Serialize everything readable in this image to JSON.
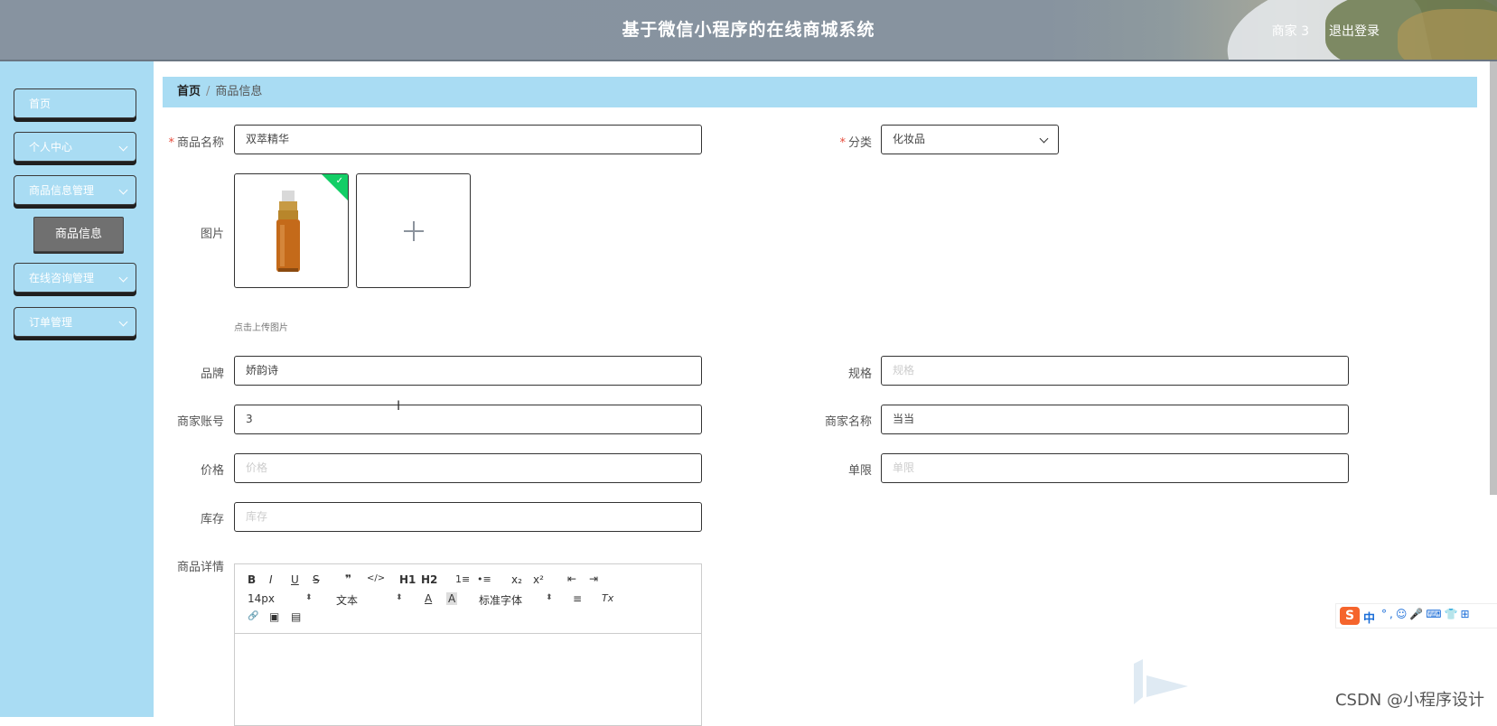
{
  "header": {
    "title": "基于微信小程序的在线商城系统",
    "user": "商家 3",
    "logout": "退出登录"
  },
  "sidebar": {
    "items": [
      {
        "label": "首页"
      },
      {
        "label": "个人中心"
      },
      {
        "label": "商品信息管理"
      },
      {
        "label": "在线咨询管理"
      },
      {
        "label": "订单管理"
      }
    ],
    "active_sub": "商品信息"
  },
  "breadcrumb": {
    "home": "首页",
    "current": "商品信息"
  },
  "form": {
    "name_label": "商品名称",
    "name_value": "双萃精华",
    "category_label": "分类",
    "category_value": "化妆品",
    "image_label": "图片",
    "upload_hint": "点击上传图片",
    "brand_label": "品牌",
    "brand_value": "娇韵诗",
    "spec_label": "规格",
    "spec_placeholder": "规格",
    "merchant_account_label": "商家账号",
    "merchant_account_value": "3",
    "merchant_name_label": "商家名称",
    "merchant_name_value": "当当",
    "price_label": "价格",
    "price_placeholder": "价格",
    "limit_label": "单限",
    "limit_placeholder": "单限",
    "stock_label": "库存",
    "stock_placeholder": "库存",
    "detail_label": "商品详情"
  },
  "editor": {
    "font_size": "14px",
    "format": "文本",
    "font_family": "标准字体",
    "buttons": [
      "B",
      "I",
      "U",
      "S",
      "❞",
      "</>",
      "H1",
      "H2",
      "1≡",
      "•≡",
      "x₂",
      "x²",
      "⇤",
      "⇥",
      "A",
      "A",
      "≡",
      "Tx",
      "🔗",
      "▣",
      "▤"
    ]
  },
  "ime": {
    "logo": "S",
    "lang": "中",
    "icons": "°,☺🎤⌨👕⊞"
  },
  "watermark": "CSDN @小程序设计"
}
